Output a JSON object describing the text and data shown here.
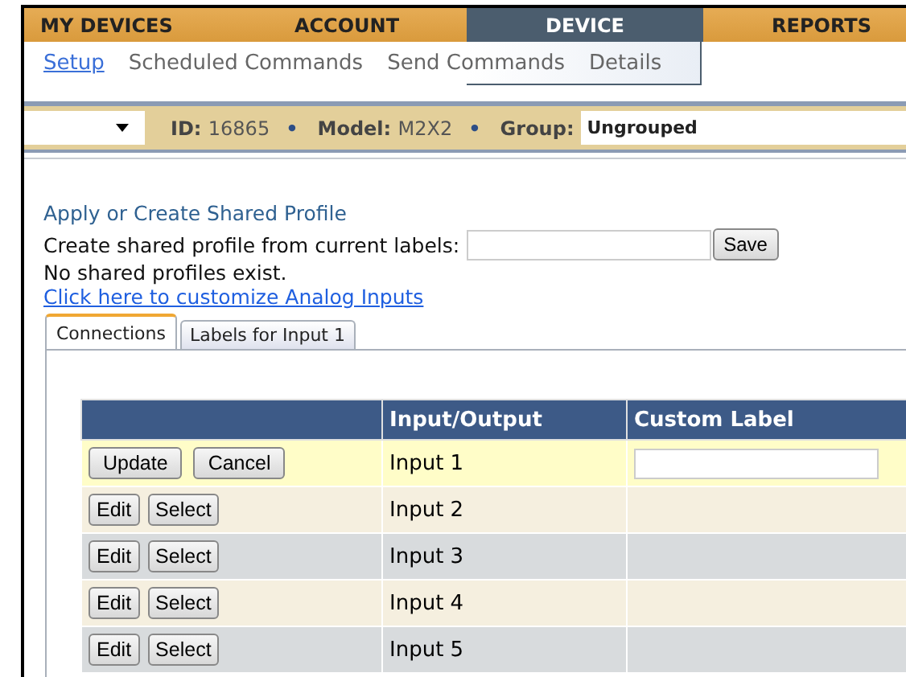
{
  "nav_tabs": [
    {
      "label": "MY DEVICES",
      "selected": false
    },
    {
      "label": "ACCOUNT",
      "selected": false
    },
    {
      "label": "DEVICE",
      "selected": true
    },
    {
      "label": "REPORTS",
      "selected": false
    }
  ],
  "sub_menu": [
    {
      "label": "Setup",
      "selected": true
    },
    {
      "label": "Scheduled Commands",
      "selected": false
    },
    {
      "label": "Send Commands",
      "selected": false
    },
    {
      "label": "Details",
      "selected": false
    }
  ],
  "device_bar": {
    "fields": [
      {
        "label": "ID:",
        "value": "16865"
      },
      {
        "label": "Model:",
        "value": "M2X2"
      }
    ],
    "separator": "•",
    "group": {
      "label": "Group:",
      "value": "Ungrouped"
    }
  },
  "profile": {
    "heading": "Apply or Create Shared Profile",
    "create_label": "Create shared profile from current labels:",
    "save_button": "Save",
    "message": "No shared profiles exist.",
    "customize_link": "Click here to customize Analog Inputs"
  },
  "tabs": [
    {
      "label": "Connections",
      "selected": true
    },
    {
      "label": "Labels for Input 1",
      "selected": false
    }
  ],
  "table": {
    "columns": [
      "Input/Output",
      "Custom Label"
    ],
    "rows": [
      {
        "editing": true,
        "buttons": [
          "Update",
          "Cancel"
        ],
        "io": "Input 1"
      },
      {
        "editing": false,
        "buttons": [
          "Edit",
          "Select"
        ],
        "io": "Input 2"
      },
      {
        "editing": false,
        "buttons": [
          "Edit",
          "Select"
        ],
        "io": "Input 3"
      },
      {
        "editing": false,
        "buttons": [
          "Edit",
          "Select"
        ],
        "io": "Input 4"
      },
      {
        "editing": false,
        "buttons": [
          "Edit",
          "Select"
        ],
        "io": "Input 5"
      }
    ]
  }
}
